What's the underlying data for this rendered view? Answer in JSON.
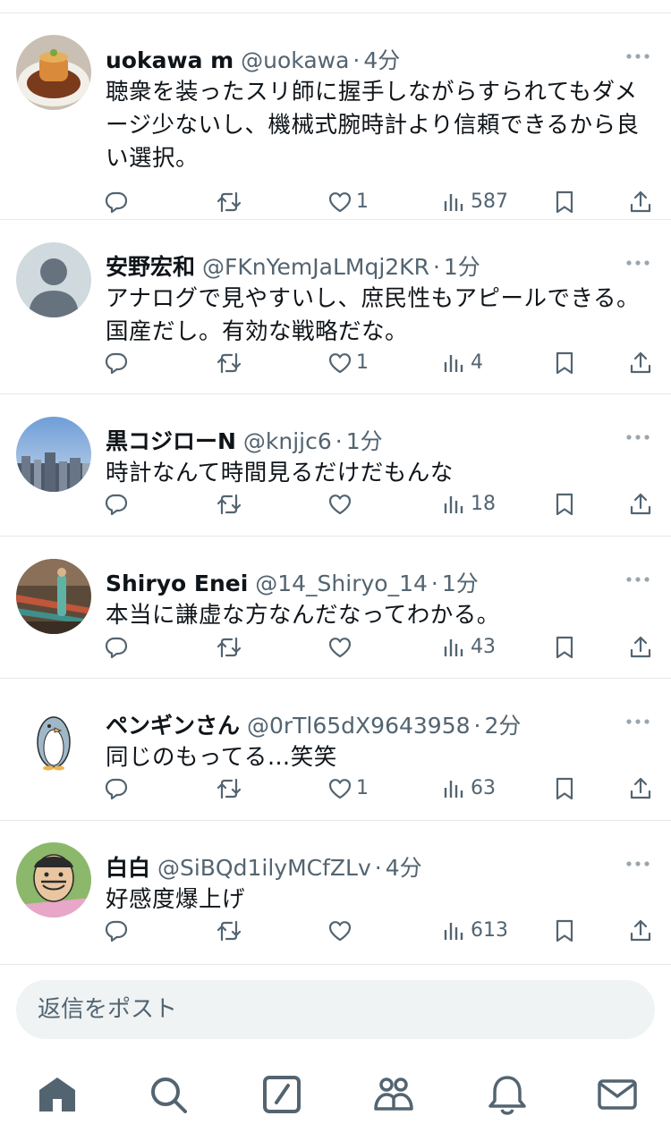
{
  "tweets": [
    {
      "name": "uokawa m",
      "handle": "@uokawa",
      "time": "4分",
      "text": "聴衆を装ったスリ師に握手しながらすられてもダメージ少ないし、機械式腕時計より信頼できるから良い選択。",
      "likes": "1",
      "views": "587",
      "avatar": "food-photo"
    },
    {
      "name": "安野宏和",
      "handle": "@FKnYemJaLMqj2KR",
      "time": "1分",
      "text": "アナログで見やすいし、庶民性もアピールできる。国産だし。有効な戦略だな。",
      "likes": "1",
      "views": "4",
      "avatar": "default-person"
    },
    {
      "name": "黒コジローN",
      "handle": "@knjjc6",
      "time": "1分",
      "text": "時計なんて時間見るだけだもんな",
      "likes": "",
      "views": "18",
      "avatar": "city-skyline"
    },
    {
      "name": "Shiryo Enei",
      "handle": "@14_Shiryo_14",
      "time": "1分",
      "text": "本当に謙虚な方なんだなってわかる。",
      "likes": "",
      "views": "43",
      "avatar": "street-photo"
    },
    {
      "name": "ペンギンさん",
      "handle": "@0rTl65dX9643958",
      "time": "2分",
      "text": "同じのもってる…笑笑",
      "likes": "1",
      "views": "63",
      "avatar": "penguin-illustration"
    },
    {
      "name": "白白",
      "handle": "@SiBQd1ilyMCfZLv",
      "time": "4分",
      "text": "好感度爆上げ",
      "likes": "",
      "views": "613",
      "avatar": "cartoon-character"
    }
  ],
  "separator": "·",
  "reply_box": {
    "placeholder": "返信をポスト"
  },
  "nav": [
    "home-icon",
    "search-icon",
    "compose-icon",
    "communities-icon",
    "notifications-icon",
    "messages-icon"
  ],
  "colors": {
    "text": "#0f1419",
    "secondary": "#536471",
    "divider": "#e6e9ec",
    "input_bg": "#eff3f4"
  }
}
